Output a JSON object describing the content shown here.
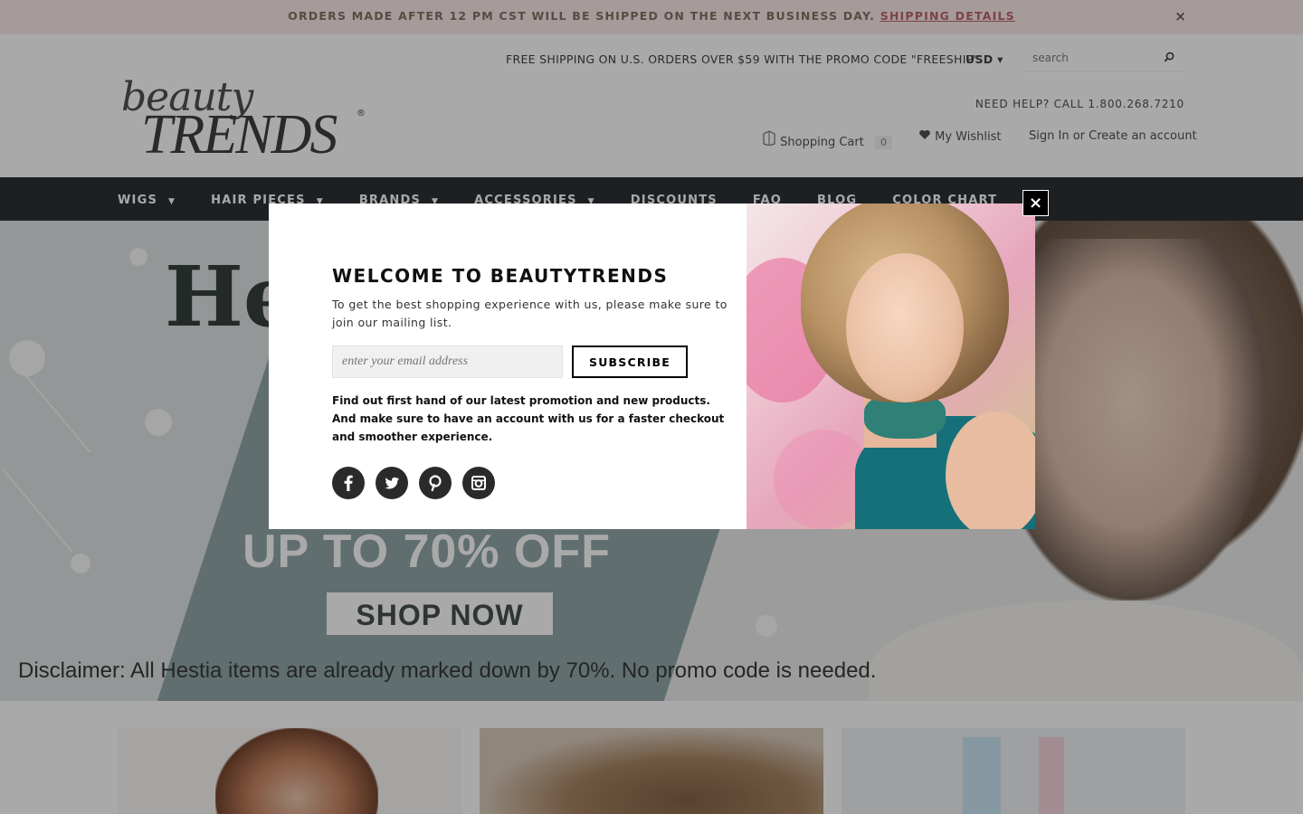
{
  "announcement": {
    "text": "ORDERS MADE AFTER 12 PM CST WILL BE SHIPPED ON THE NEXT BUSINESS DAY.",
    "link": "SHIPPING DETAILS",
    "close": "×"
  },
  "header": {
    "logo_top": "beauty",
    "logo_bottom": "TRENDS",
    "logo_reg": "®",
    "promo": "FREE SHIPPING ON U.S. ORDERS OVER $59 WITH THE PROMO CODE \"FREESHIP\"",
    "currency": "USD",
    "currency_caret": "▾",
    "search_placeholder": "search",
    "help": "NEED HELP? CALL 1.800.268.7210",
    "cart_label": "Shopping Cart",
    "cart_count": "0",
    "wishlist_label": "My Wishlist",
    "sign_in": "Sign In or Create an account"
  },
  "nav": {
    "items": [
      {
        "label": "WIGS",
        "caret": "▼"
      },
      {
        "label": "HAIR PIECES",
        "caret": "▼"
      },
      {
        "label": "BRANDS",
        "caret": "▼"
      },
      {
        "label": "ACCESSORIES",
        "caret": "▼"
      },
      {
        "label": "DISCOUNTS"
      },
      {
        "label": "FAQ"
      },
      {
        "label": "BLOG"
      },
      {
        "label": "COLOR CHART"
      }
    ]
  },
  "hero": {
    "title_fragment": "He",
    "offer": "UP TO 70% OFF",
    "cta": "SHOP NOW",
    "disclaimer": "Disclaimer: All Hestia items are already marked down by 70%. No promo code is needed."
  },
  "modal": {
    "close": "×",
    "title": "WELCOME TO BEAUTYTRENDS",
    "intro": "To get the best shopping experience with us, please make sure to join our mailing list.",
    "email_placeholder": "enter your email address",
    "subscribe_label": "SUBSCRIBE",
    "find_text": "Find out first hand of our latest promotion and new products. And make sure to have an account with us for a faster checkout and smoother experience.",
    "social": [
      "f",
      "t",
      "p",
      "ig"
    ]
  },
  "colors": {
    "announce_bg": "#fae8e8",
    "nav_bg": "#1e2327",
    "link_accent": "#b65a63"
  }
}
